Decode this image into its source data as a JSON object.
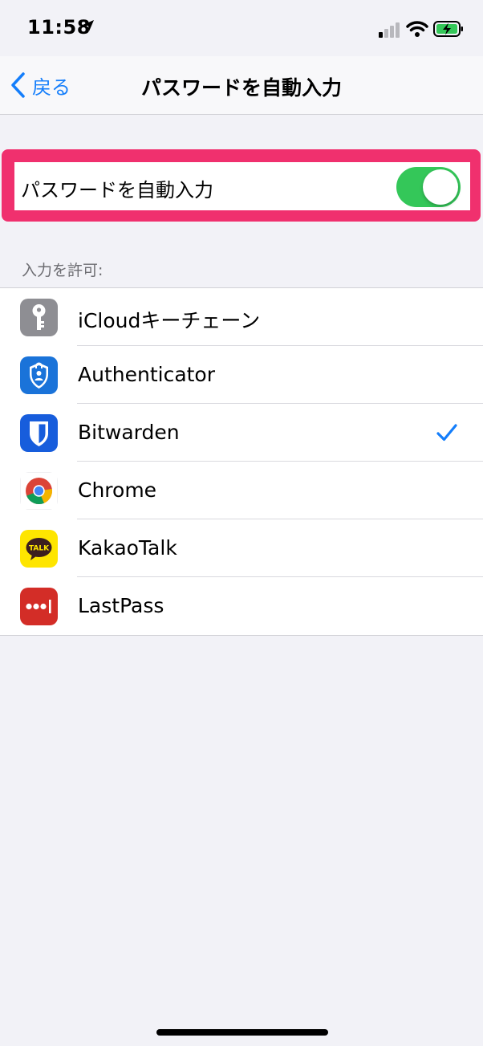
{
  "status_bar": {
    "time": "11:58",
    "location_icon": "location-arrow-icon",
    "signal_icon": "cellular-signal-icon",
    "wifi_icon": "wifi-icon",
    "battery_icon": "battery-charging-icon"
  },
  "nav": {
    "back_label": "戻る",
    "title": "パスワードを自動入力"
  },
  "autofill": {
    "label": "パスワードを自動入力",
    "enabled": true
  },
  "section": {
    "header": "入力を許可:"
  },
  "apps": [
    {
      "name": "iCloudキーチェーン",
      "icon": "icloud-keychain-icon",
      "checked": false
    },
    {
      "name": "Authenticator",
      "icon": "authenticator-icon",
      "checked": false
    },
    {
      "name": "Bitwarden",
      "icon": "bitwarden-icon",
      "checked": true
    },
    {
      "name": "Chrome",
      "icon": "chrome-icon",
      "checked": false
    },
    {
      "name": "KakaoTalk",
      "icon": "kakaotalk-icon",
      "checked": false
    },
    {
      "name": "LastPass",
      "icon": "lastpass-icon",
      "checked": false
    }
  ],
  "colors": {
    "accent": "#147efb",
    "toggle_on": "#34c759",
    "highlight": "#f0306e"
  }
}
